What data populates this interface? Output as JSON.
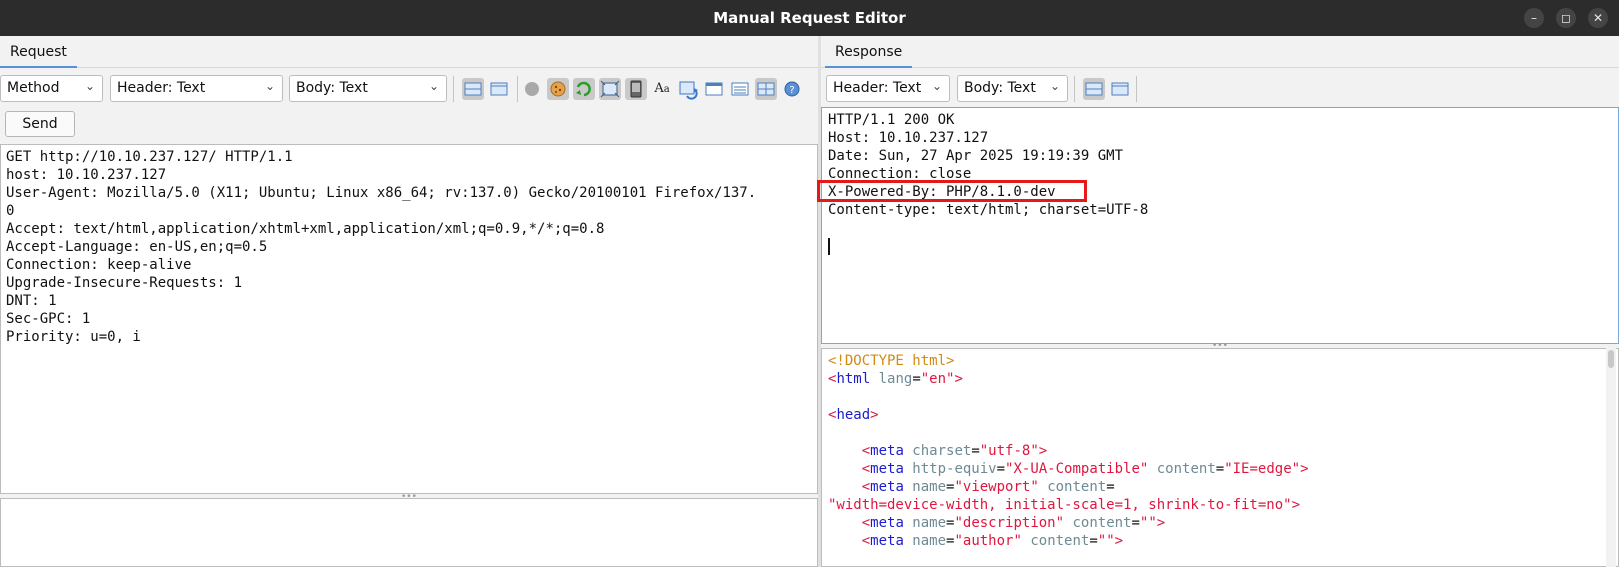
{
  "window": {
    "title": "Manual Request Editor",
    "controls": {
      "minimize": "–",
      "maximize": "◻",
      "close": "✕"
    }
  },
  "request": {
    "tab_label": "Request",
    "method_combo": "Method",
    "header_combo": "Header: Text",
    "body_combo": "Body: Text",
    "send_label": "Send",
    "toolbar_icons": [
      "layout-split-icon",
      "layout-tabs-icon",
      "circle-icon",
      "cookie-icon",
      "follow-redirect-icon",
      "frame-icon",
      "device-icon",
      "font-icon",
      "refresh-icon",
      "window-icon",
      "list-icon",
      "grid-icon",
      "help-icon"
    ],
    "header_lines": [
      "GET http://10.10.237.127/ HTTP/1.1",
      "host: 10.10.237.127",
      "User-Agent: Mozilla/5.0 (X11; Ubuntu; Linux x86_64; rv:137.0) Gecko/20100101 Firefox/137.",
      "0",
      "Accept: text/html,application/xhtml+xml,application/xml;q=0.9,*/*;q=0.8",
      "Accept-Language: en-US,en;q=0.5",
      "Connection: keep-alive",
      "Upgrade-Insecure-Requests: 1",
      "DNT: 1",
      "Sec-GPC: 1",
      "Priority: u=0, i"
    ]
  },
  "response": {
    "tab_label": "Response",
    "header_combo": "Header: Text",
    "body_combo": "Body: Text",
    "header_lines": [
      "HTTP/1.1 200 OK",
      "Host: 10.10.237.127",
      "Date: Sun, 27 Apr 2025 19:19:39 GMT",
      "Connection: close",
      "X-Powered-By: PHP/8.1.0-dev",
      "Content-type: text/html; charset=UTF-8"
    ],
    "body_lines": [
      [
        [
          "doc",
          "<!DOCTYPE html>"
        ]
      ],
      [
        [
          "br",
          "<"
        ],
        [
          "tag",
          "html"
        ],
        [
          "attr",
          " lang"
        ],
        [
          "txt",
          "="
        ],
        [
          "str",
          "\"en\""
        ],
        [
          "br",
          ">"
        ]
      ],
      [],
      [
        [
          "br",
          "<"
        ],
        [
          "tag",
          "head"
        ],
        [
          "br",
          ">"
        ]
      ],
      [],
      [
        [
          "txt",
          "    "
        ],
        [
          "br",
          "<"
        ],
        [
          "tag",
          "meta"
        ],
        [
          "attr",
          " charset"
        ],
        [
          "txt",
          "="
        ],
        [
          "str",
          "\"utf-8\""
        ],
        [
          "br",
          ">"
        ]
      ],
      [
        [
          "txt",
          "    "
        ],
        [
          "br",
          "<"
        ],
        [
          "tag",
          "meta"
        ],
        [
          "attr",
          " http-equiv"
        ],
        [
          "txt",
          "="
        ],
        [
          "str",
          "\"X-UA-Compatible\""
        ],
        [
          "attr",
          " content"
        ],
        [
          "txt",
          "="
        ],
        [
          "str",
          "\"IE=edge\""
        ],
        [
          "br",
          ">"
        ]
      ],
      [
        [
          "txt",
          "    "
        ],
        [
          "br",
          "<"
        ],
        [
          "tag",
          "meta"
        ],
        [
          "attr",
          " name"
        ],
        [
          "txt",
          "="
        ],
        [
          "str",
          "\"viewport\""
        ],
        [
          "attr",
          " content"
        ],
        [
          "txt",
          "="
        ]
      ],
      [
        [
          "str",
          "\"width=device-width, initial-scale=1, shrink-to-fit=no\""
        ],
        [
          "br",
          ">"
        ]
      ],
      [
        [
          "txt",
          "    "
        ],
        [
          "br",
          "<"
        ],
        [
          "tag",
          "meta"
        ],
        [
          "attr",
          " name"
        ],
        [
          "txt",
          "="
        ],
        [
          "str",
          "\"description\""
        ],
        [
          "attr",
          " content"
        ],
        [
          "txt",
          "="
        ],
        [
          "str",
          "\"\""
        ],
        [
          "br",
          ">"
        ]
      ],
      [
        [
          "txt",
          "    "
        ],
        [
          "br",
          "<"
        ],
        [
          "tag",
          "meta"
        ],
        [
          "attr",
          " name"
        ],
        [
          "txt",
          "="
        ],
        [
          "str",
          "\"author\""
        ],
        [
          "attr",
          " content"
        ],
        [
          "txt",
          "="
        ],
        [
          "str",
          "\"\""
        ],
        [
          "br",
          ">"
        ]
      ]
    ]
  },
  "colors": {
    "title_bar": "#2c2c2c",
    "highlight_box": "#e41a1a",
    "tab_accent": "#5b8fd6"
  }
}
